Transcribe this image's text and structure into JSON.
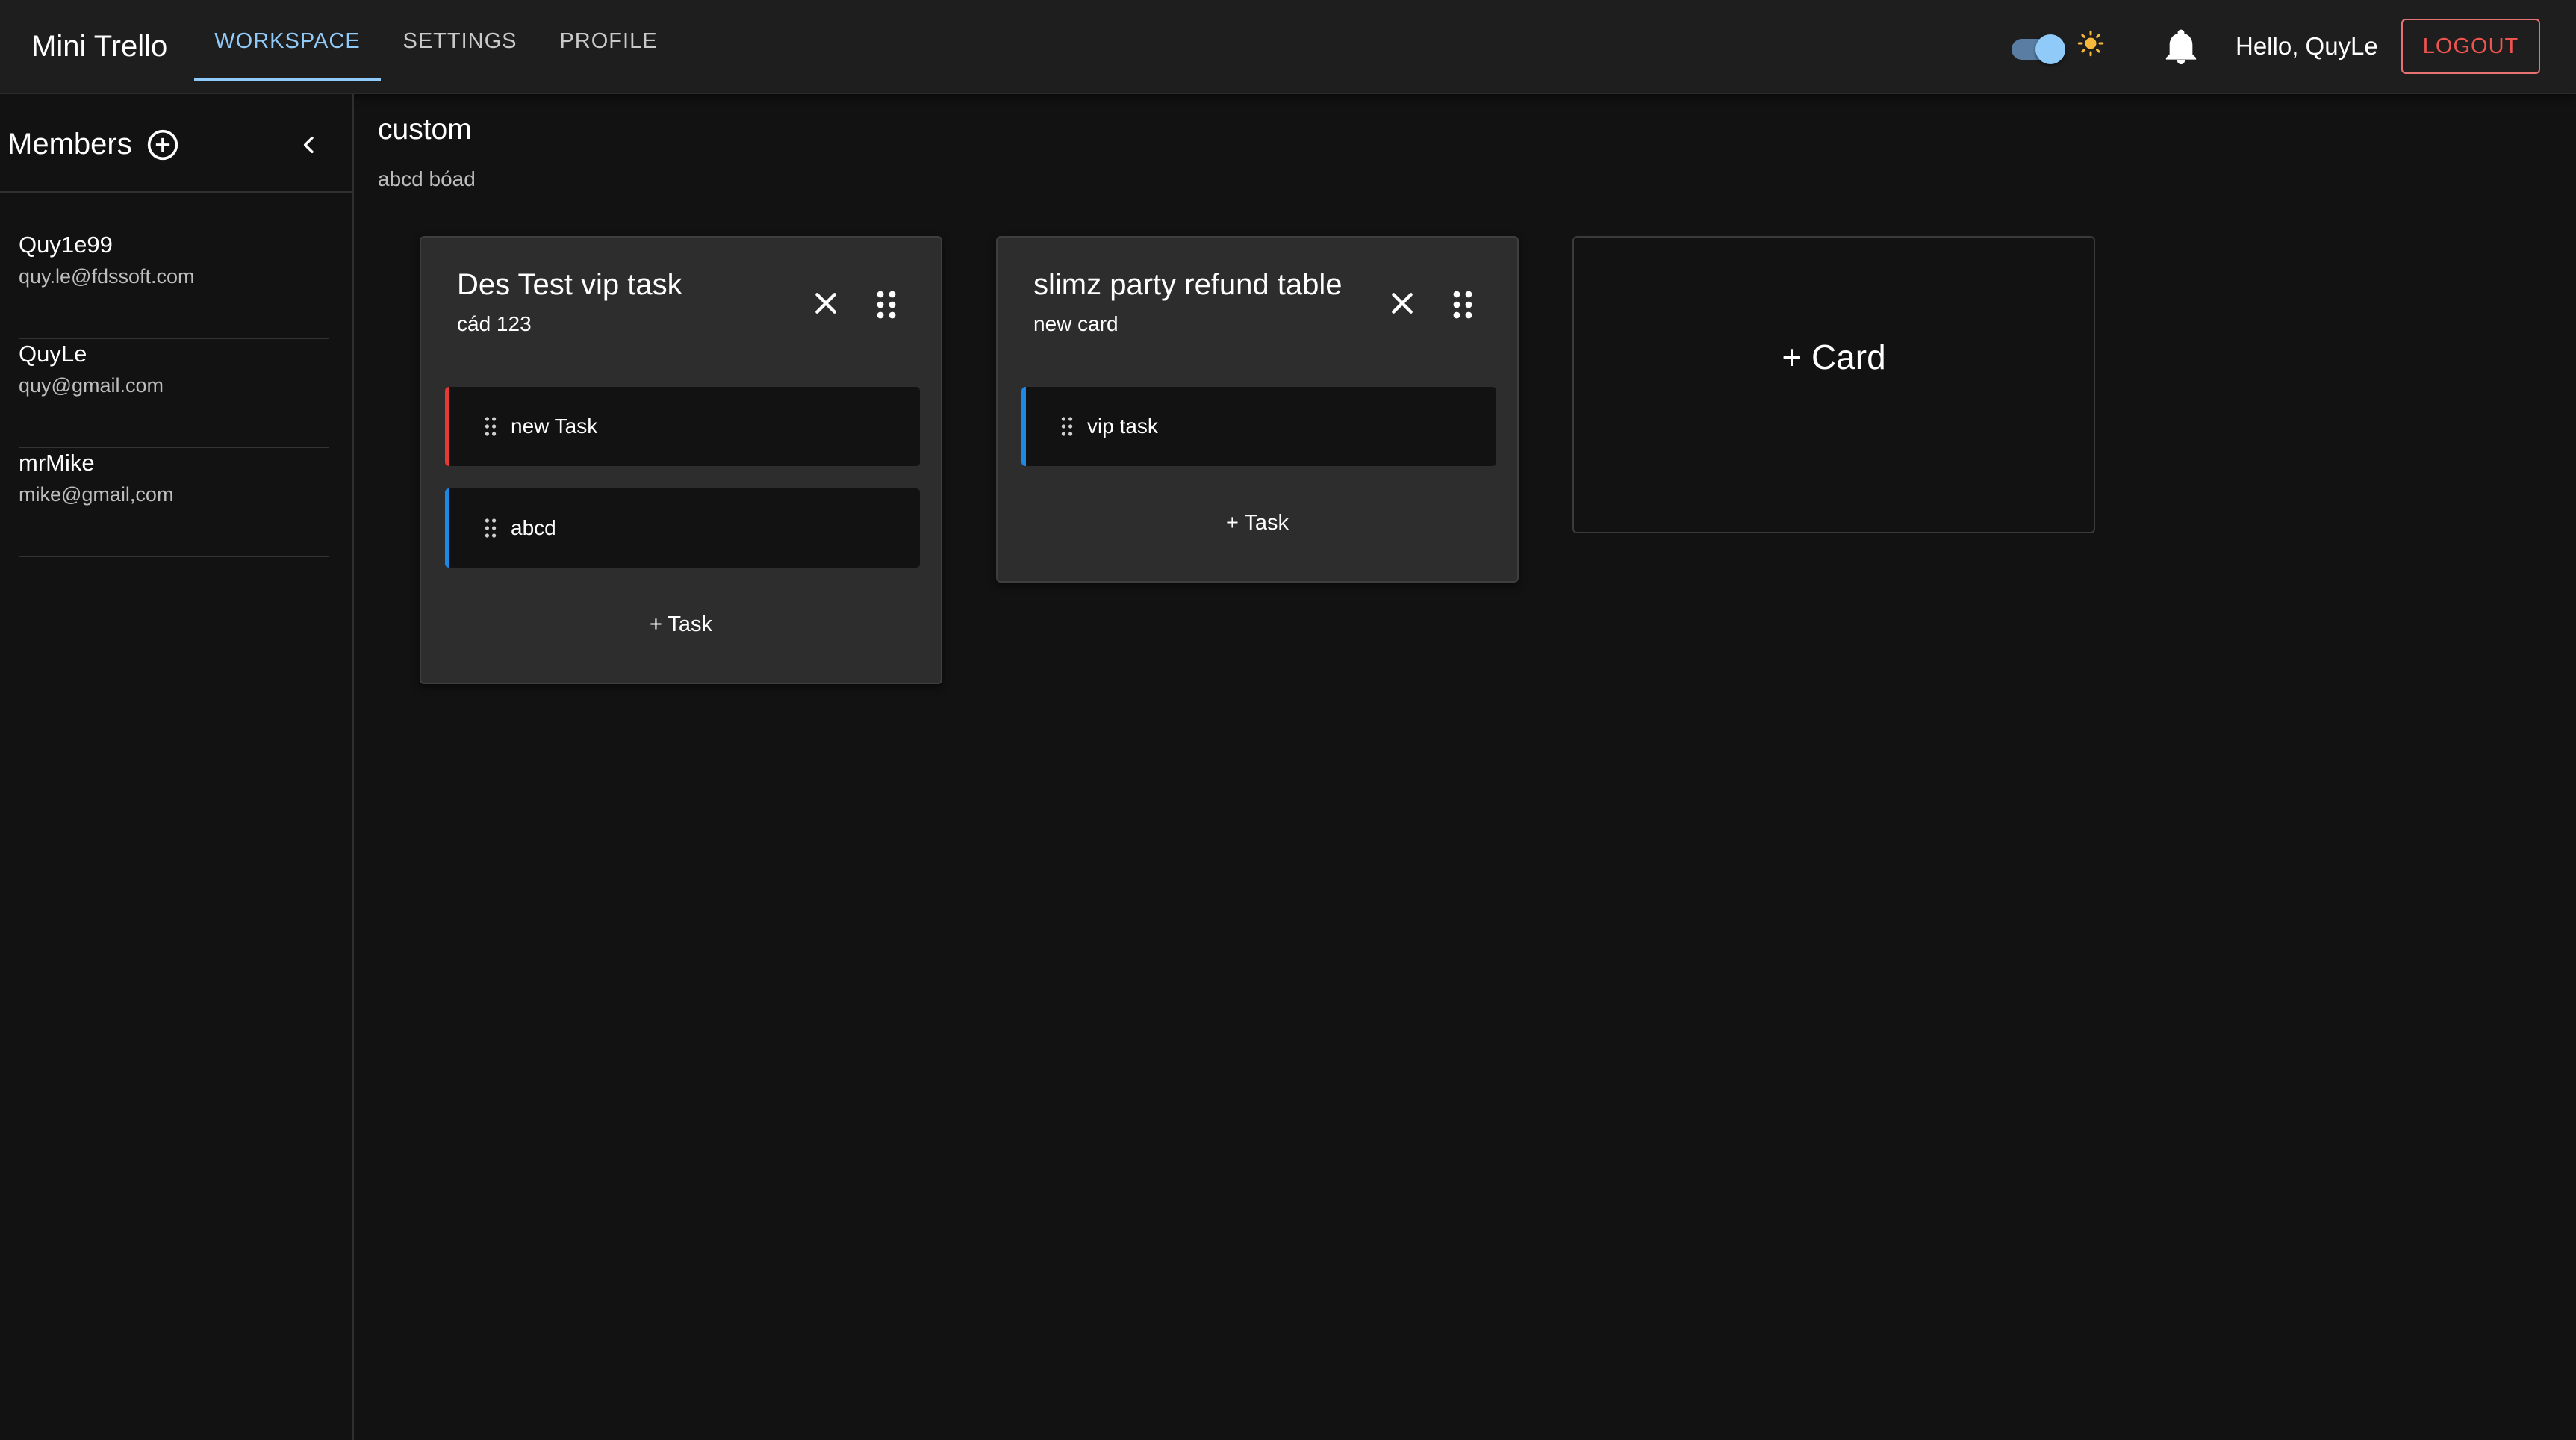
{
  "app": {
    "title": "Mini Trello"
  },
  "nav": {
    "tabs": [
      {
        "label": "WORKSPACE",
        "active": true
      },
      {
        "label": "SETTINGS",
        "active": false
      },
      {
        "label": "PROFILE",
        "active": false
      }
    ]
  },
  "header": {
    "theme_toggle_on": true,
    "greeting": "Hello, QuyLe",
    "logout_label": "LOGOUT"
  },
  "sidebar": {
    "title": "Members",
    "members": [
      {
        "name": "Quy1e99",
        "email": "quy.le@fdssoft.com"
      },
      {
        "name": "QuyLe",
        "email": "quy@gmail.com"
      },
      {
        "name": "mrMike",
        "email": "mike@gmail,com"
      }
    ]
  },
  "board": {
    "title": "custom",
    "description": "abcd bóad",
    "cards": [
      {
        "title": "Des Test vip task",
        "subtitle": "cád 123",
        "tasks": [
          {
            "label": "new Task",
            "accent": "#e53935"
          },
          {
            "label": "abcd",
            "accent": "#1e88e5"
          }
        ],
        "add_task_label": "+ Task"
      },
      {
        "title": "slimz party refund table",
        "subtitle": "new card",
        "tasks": [
          {
            "label": "vip task",
            "accent": "#1e88e5"
          }
        ],
        "add_task_label": "+ Task"
      }
    ],
    "add_card_label": "+ Card"
  },
  "colors": {
    "accent": "#90caf9",
    "logout": "#ef5350",
    "background": "#121212",
    "appbar": "#1e1e1e",
    "card": "#2d2d2d"
  },
  "icons": {
    "theme": "sun-icon",
    "notifications": "bell-icon",
    "add_member": "plus-circle-icon",
    "collapse": "chevron-left-icon",
    "close": "close-icon",
    "drag": "drag-handle-icon"
  }
}
